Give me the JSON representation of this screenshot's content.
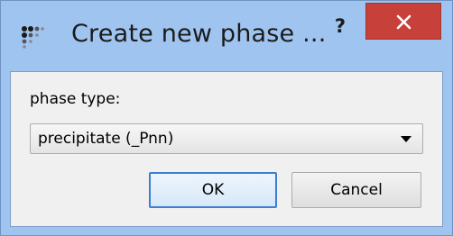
{
  "window": {
    "title": "Create new phase ...",
    "help_label": "?",
    "close_icon": "close-icon",
    "app_icon": "dots-logo-icon"
  },
  "form": {
    "phase_type_label": "phase type:",
    "phase_type_value": "precipitate (_Pnn)"
  },
  "buttons": {
    "ok_label": "OK",
    "cancel_label": "Cancel"
  },
  "colors": {
    "frame": "#a0c4f0",
    "close_button": "#c7403a",
    "client_background": "#f0f0f0",
    "default_button_border": "#3c7fd0"
  }
}
